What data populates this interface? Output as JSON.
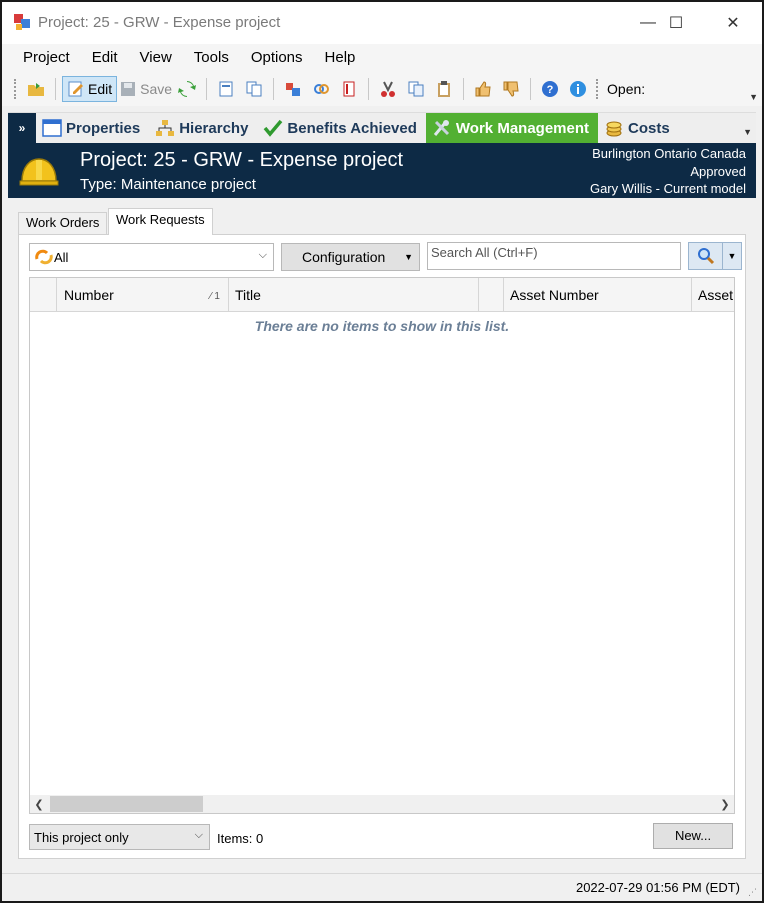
{
  "window": {
    "title": "Project: 25 - GRW - Expense project",
    "controls": {
      "minimize": "—",
      "maximize": "☐",
      "close": "✕"
    }
  },
  "menu": [
    "Project",
    "Edit",
    "View",
    "Tools",
    "Options",
    "Help"
  ],
  "toolbar": {
    "edit_label": "Edit",
    "save_label": "Save",
    "open_label": "Open:"
  },
  "nav": {
    "items": [
      {
        "label": "Properties",
        "icon": "window-icon"
      },
      {
        "label": "Hierarchy",
        "icon": "hierarchy-icon"
      },
      {
        "label": "Benefits Achieved",
        "icon": "checkmark-icon"
      },
      {
        "label": "Work Management",
        "icon": "tools-icon",
        "active": true
      },
      {
        "label": "Costs",
        "icon": "coins-icon"
      }
    ]
  },
  "header": {
    "title": "Project: 25 - GRW - Expense project",
    "type": "Type: Maintenance project",
    "location": "Burlington Ontario Canada",
    "status": "Approved",
    "model": "Gary Willis - Current model"
  },
  "tabs": [
    {
      "label": "Work Orders",
      "selected": false
    },
    {
      "label": "Work Requests",
      "selected": true
    }
  ],
  "filter": {
    "selected": "All"
  },
  "configuration_label": "Configuration",
  "search": {
    "placeholder": "Search All  (Ctrl+F)"
  },
  "grid": {
    "columns": [
      "",
      "Number",
      "Title",
      "",
      "Asset Number",
      "Asset D"
    ],
    "sort_indicator": "⁄ 1",
    "empty_message": "There are no items to show in this list."
  },
  "footer": {
    "scope": "This project only",
    "items_count": "Items: 0",
    "new_button": "New..."
  },
  "status": {
    "timestamp": "2022-07-29 01:56 PM (EDT)"
  },
  "colors": {
    "banner": "#0d2a45",
    "active_nav": "#52b032",
    "empty_text": "#6b7f96"
  }
}
